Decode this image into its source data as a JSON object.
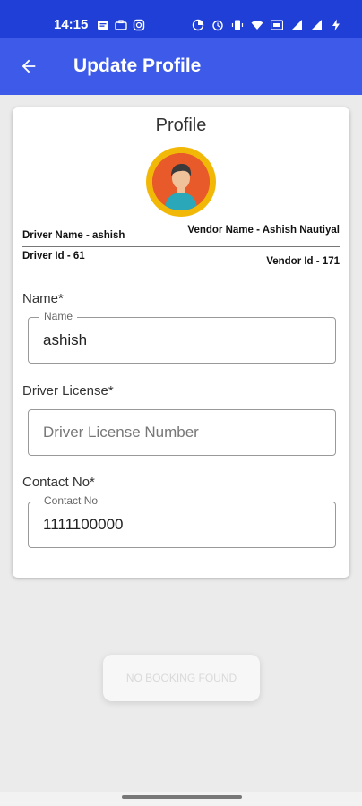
{
  "status_bar": {
    "time": "14:15",
    "left_icons": [
      "message-icon",
      "briefcase-icon",
      "instagram-icon"
    ],
    "right_icons": [
      "data-saver-icon",
      "alarm-icon",
      "vibrate-icon",
      "wifi-icon",
      "volte-icon",
      "signal-icon",
      "signal-icon",
      "battery-charging-icon"
    ]
  },
  "app_bar": {
    "back_icon": "arrow-left-icon",
    "title": "Update Profile"
  },
  "profile": {
    "title": "Profile",
    "avatar_icon": "user-avatar-icon",
    "driver_name": "Driver Name - ashish",
    "vendor_name": "Vendor Name - Ashish Nautiyal",
    "driver_id": "Driver Id - 61",
    "vendor_id": "Vendor Id - 171"
  },
  "form": {
    "name": {
      "label": "Name*",
      "float_label": "Name",
      "value": "ashish"
    },
    "license": {
      "label": "Driver License*",
      "placeholder": "Driver License Number",
      "value": ""
    },
    "contact": {
      "label": "Contact No*",
      "float_label": "Contact No",
      "value": "1111100000"
    }
  },
  "toast": {
    "text": "NO BOOKING FOUND"
  },
  "colors": {
    "status_bar": "#1f3fd6",
    "app_bar": "#3d5ae8",
    "avatar_ring": "#f2b807",
    "avatar_bg": "#e85a2a"
  }
}
